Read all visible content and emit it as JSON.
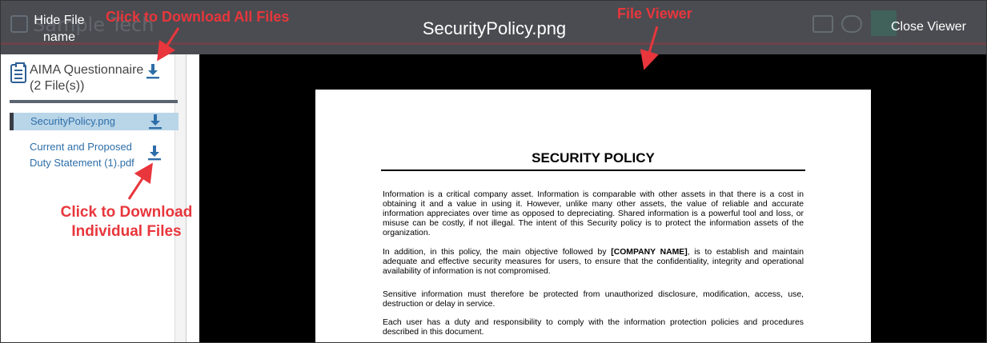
{
  "viewer": {
    "hide_label_line1": "Hide File",
    "hide_label_line2": "name",
    "title": "SecurityPolicy.png",
    "close_label": "Close Viewer"
  },
  "sidebar": {
    "group_title": "AIMA Questionnaire (2 File(s))",
    "files": [
      {
        "name": "SecurityPolicy.png",
        "active": true
      },
      {
        "name_line1": "Current and Proposed",
        "name_line2": "Duty Statement (1).pdf",
        "active": false
      }
    ]
  },
  "document": {
    "title": "SECURITY POLICY",
    "paragraphs": [
      "Information is a critical company asset. Information is comparable with other assets in that there is a cost in obtaining it and a value in using it. However, unlike many other assets, the value of reliable and accurate information appreciates over time as opposed to depreciating. Shared information is a powerful tool and loss, or misuse can be costly, if not illegal. The intent of this Security policy is to protect the information assets of the organization.",
      "Sensitive information must therefore be protected from unauthorized disclosure, modification, access, use, destruction or delay in service.",
      "Each user has a duty and responsibility to comply with the information protection policies and procedures described in this document."
    ],
    "para2_prefix": "In addition, in this policy, the main objective followed by ",
    "para2_bold": "[COMPANY NAME]",
    "para2_suffix": ", is to establish and maintain adequate and effective security measures for users, to ensure that the confidentiality, integrity and operational availability of information is not compromised."
  },
  "annotations": {
    "download_all": "Click to Download All Files",
    "file_viewer": "File Viewer",
    "download_individual_line1": "Click to Download",
    "download_individual_line2": "Individual Files"
  },
  "colors": {
    "annotation": "#e8363c",
    "link": "#2d6ea8",
    "topbar": "#4a4c51"
  },
  "icons": [
    "download-icon",
    "questionnaire-icon"
  ]
}
